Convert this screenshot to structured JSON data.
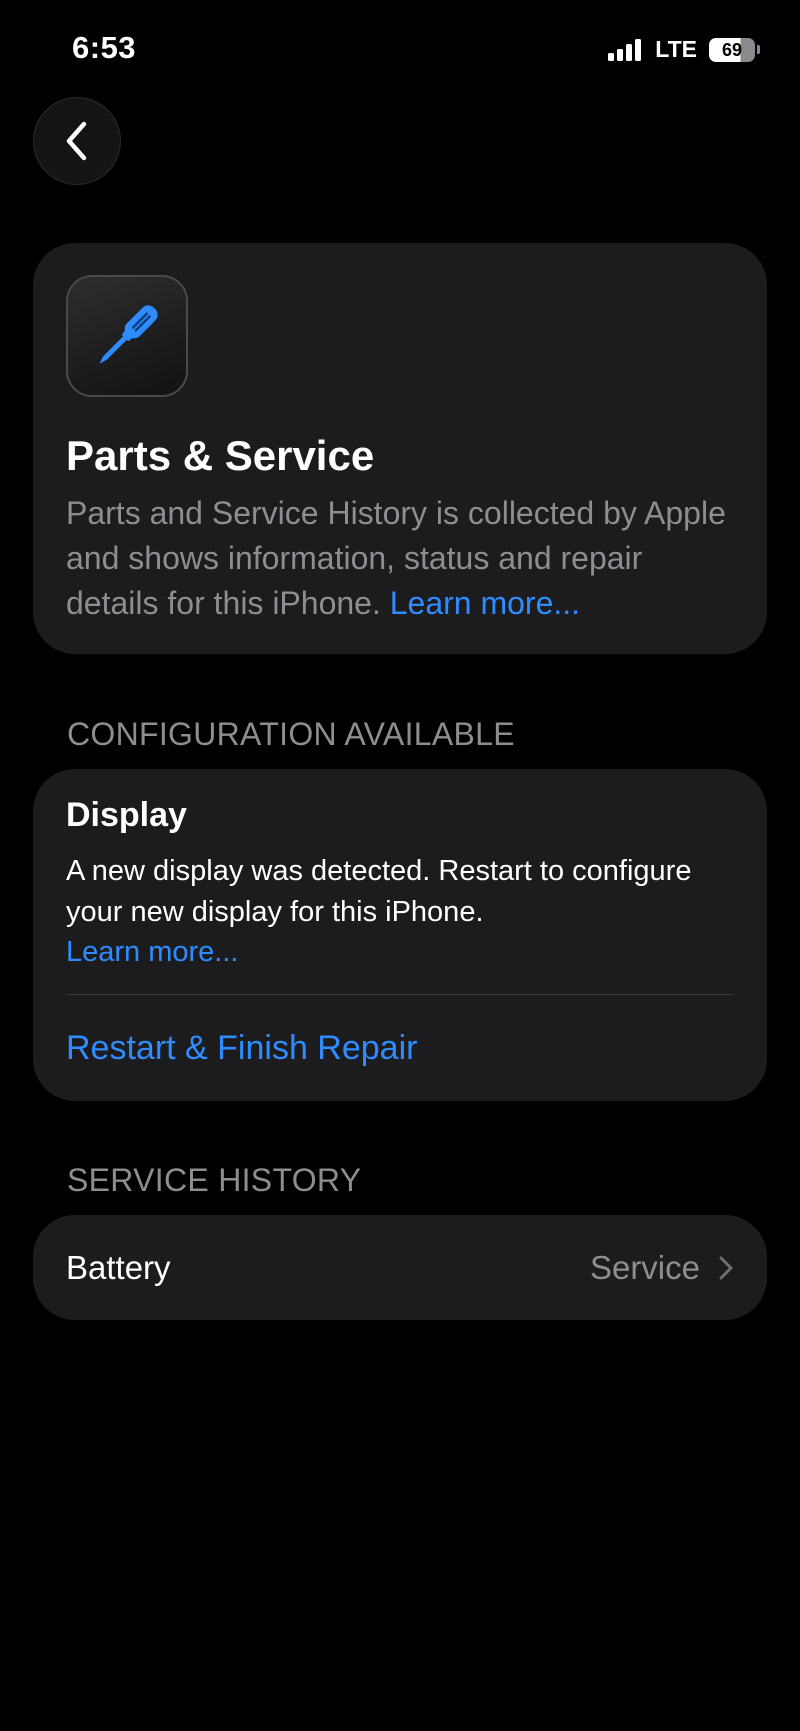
{
  "status_bar": {
    "time": "6:53",
    "network": "LTE",
    "battery_level": "69",
    "battery_fraction": 0.69
  },
  "nav": {
    "back_icon": "chevron-left-icon"
  },
  "hero": {
    "icon": "screwdriver-icon",
    "icon_color": "#2f8cff",
    "title": "Parts & Service",
    "description": "Parts and Service History is collected by Apple and shows information, status and repair details for this iPhone.",
    "learn_more": "Learn more..."
  },
  "configuration": {
    "header": "CONFIGURATION AVAILABLE",
    "title": "Display",
    "description": "A new display was detected. Restart to configure your new display for this iPhone.",
    "learn_more": "Learn more...",
    "action": "Restart & Finish Repair"
  },
  "service_history": {
    "header": "SERVICE HISTORY",
    "items": [
      {
        "label": "Battery",
        "value": "Service",
        "icon": "chevron-right-icon"
      }
    ]
  },
  "colors": {
    "background": "#000000",
    "card": "#1c1c1e",
    "accent": "#2f8cff",
    "secondary_text": "#8d8d92"
  }
}
